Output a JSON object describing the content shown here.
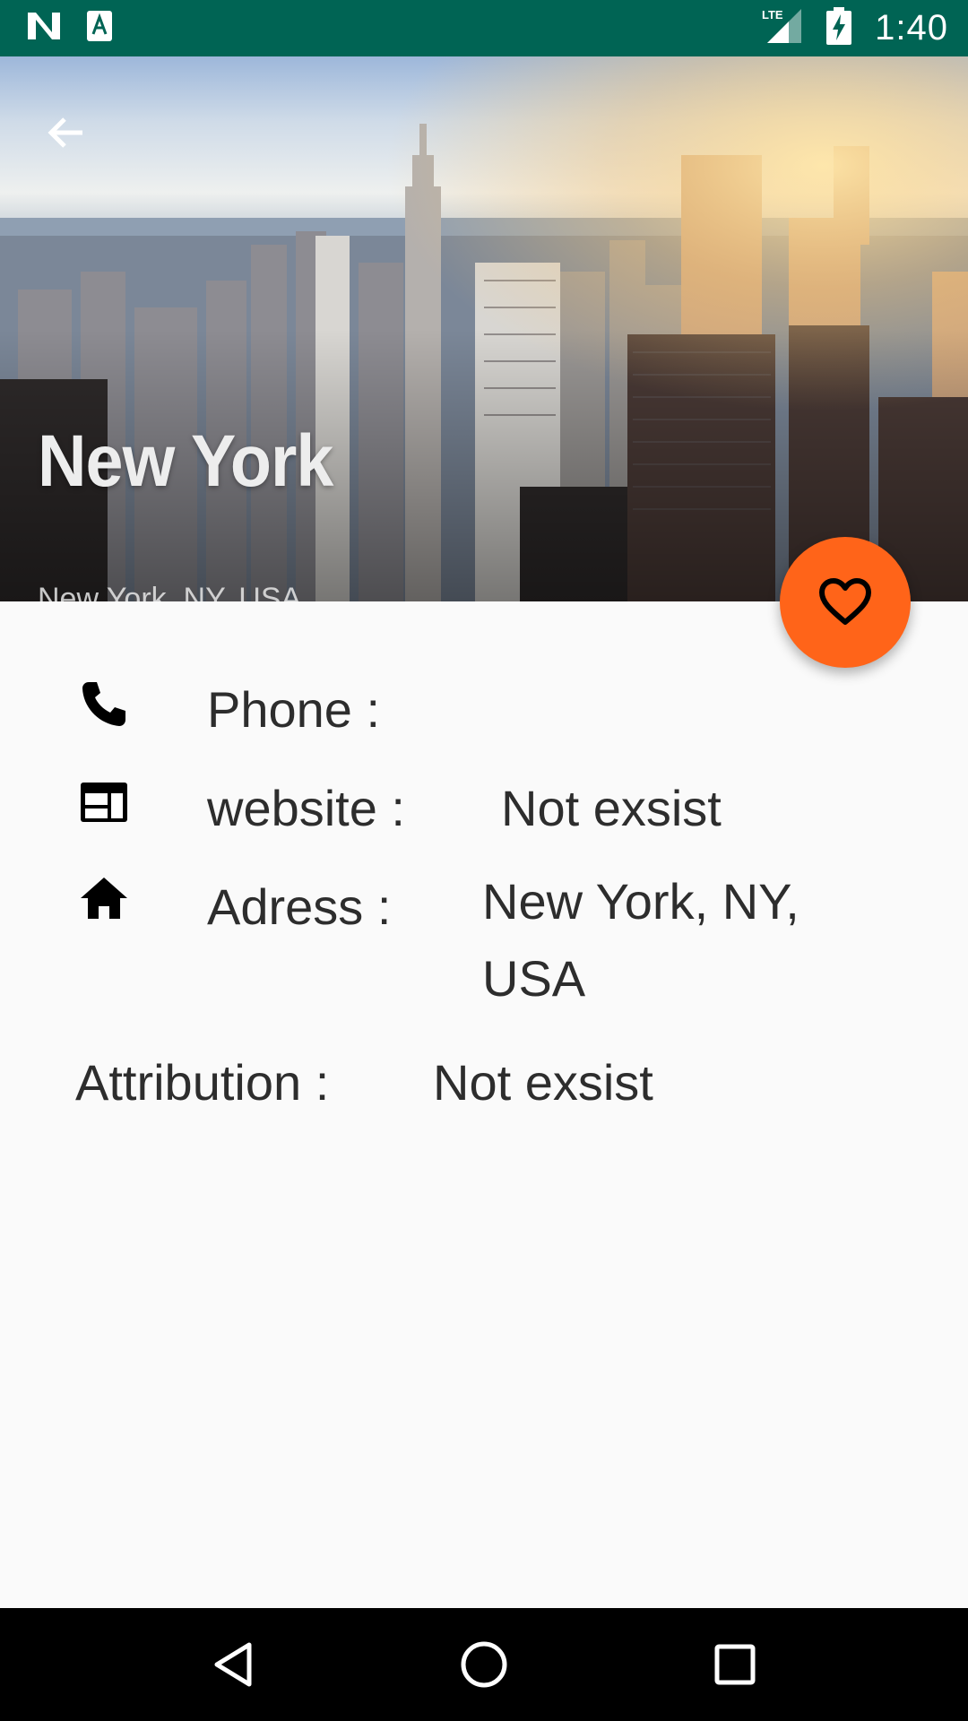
{
  "status_bar": {
    "time": "1:40",
    "network": "LTE",
    "icons": [
      "n-logo-icon",
      "accessibility-a-icon",
      "lte-signal-icon",
      "battery-charging-icon"
    ]
  },
  "header": {
    "title": "New York",
    "subtitle": "New York, NY, USA",
    "back_icon": "arrow-back-icon"
  },
  "fab": {
    "icon": "heart-outline-icon",
    "color": "#ff6419"
  },
  "details": {
    "phone": {
      "label": "Phone :",
      "value": "",
      "icon": "phone-icon"
    },
    "website": {
      "label": "website :",
      "value": "Not exsist",
      "icon": "web-icon"
    },
    "address": {
      "label": "Adress :",
      "value_line1": "New York, NY,",
      "value_line2": "USA",
      "icon": "home-icon"
    },
    "attribution": {
      "label": "Attribution :",
      "value": "Not exsist"
    }
  },
  "nav_bar": {
    "icons": [
      "back-triangle-icon",
      "home-circle-icon",
      "recents-square-icon"
    ]
  },
  "colors": {
    "status_bar": "#006454",
    "accent": "#ff6419",
    "background": "#fafafa"
  }
}
